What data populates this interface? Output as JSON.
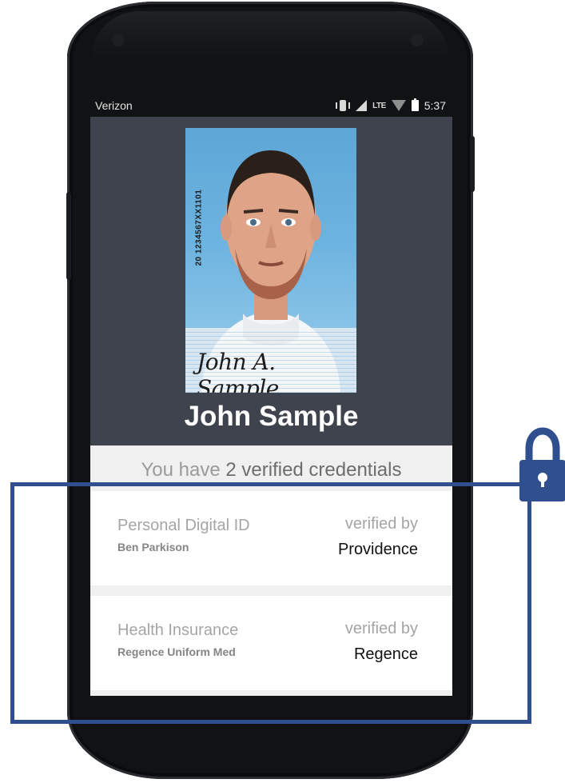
{
  "status_bar": {
    "carrier": "Verizon",
    "network": "LTE",
    "time": "5:37",
    "icons": [
      "vibrate-icon",
      "signal-icon",
      "wifi-icon",
      "battery-icon"
    ]
  },
  "profile": {
    "photo_serial": "20 1234567XX1101",
    "photo_signature": "John A. Sample",
    "name": "John Sample"
  },
  "summary": {
    "prefix": "You have ",
    "count_text": "2 verified credentials"
  },
  "credentials": [
    {
      "title": "Personal Digital ID",
      "holder": "Ben Parkison",
      "verified_label": "verified by",
      "issuer": "Providence"
    },
    {
      "title": "Health Insurance",
      "holder": "Regence Uniform Med",
      "verified_label": "verified by",
      "issuer": "Regence"
    }
  ],
  "colors": {
    "header_bg": "#3e434d",
    "highlight_border": "#2f4f8f",
    "lock": "#2f4f8f"
  }
}
